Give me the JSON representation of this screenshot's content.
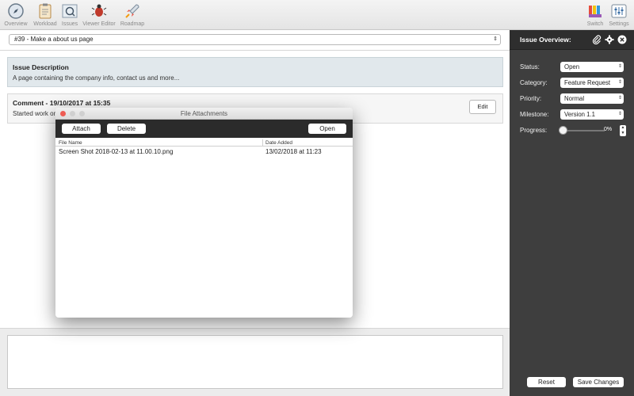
{
  "toolbar": {
    "items": [
      {
        "label": "Overview",
        "icon": "compass-icon"
      },
      {
        "label": "Workload",
        "icon": "clipboard-icon"
      },
      {
        "label": "Issues",
        "icon": "magnifier-icon"
      },
      {
        "label": "Viewer Editor",
        "icon": "bug-icon"
      },
      {
        "label": "Roadmap",
        "icon": "rocket-icon"
      }
    ],
    "right_items": [
      {
        "label": "Switch",
        "icon": "swatches-icon"
      },
      {
        "label": "Settings",
        "icon": "sliders-icon"
      }
    ]
  },
  "issue_selector": {
    "value": "#39 - Make a about us page"
  },
  "description": {
    "title": "Issue Description",
    "text": "A page containing the company info, contact us and more..."
  },
  "comment": {
    "title": "Comment - 19/10/2017 at 15:35",
    "text": "Started work on",
    "edit_label": "Edit"
  },
  "sidebar": {
    "title": "Issue Overview:",
    "fields": {
      "status": {
        "label": "Status:",
        "value": "Open"
      },
      "category": {
        "label": "Category:",
        "value": "Feature Request"
      },
      "priority": {
        "label": "Priority:",
        "value": "Normal"
      },
      "milestone": {
        "label": "Milestone:",
        "value": "Version 1.1"
      },
      "progress": {
        "label": "Progress:",
        "value_text": "0%",
        "value": 0
      }
    },
    "reset_label": "Reset",
    "save_label": "Save Changes"
  },
  "modal": {
    "title": "File Attachments",
    "attach_label": "Attach",
    "delete_label": "Delete",
    "open_label": "Open",
    "columns": {
      "file_name": "File Name",
      "date_added": "Date Added"
    },
    "files": [
      {
        "name": "Screen Shot 2018-02-13 at 11.00.10.png",
        "date": "13/02/2018 at 11:23"
      }
    ]
  },
  "colors": {
    "sidebar_bg": "#3e3e3e",
    "modal_toolbar_bg": "#2b2b2b",
    "description_bg": "#e1e8ec",
    "close_red": "#ee5c54"
  }
}
